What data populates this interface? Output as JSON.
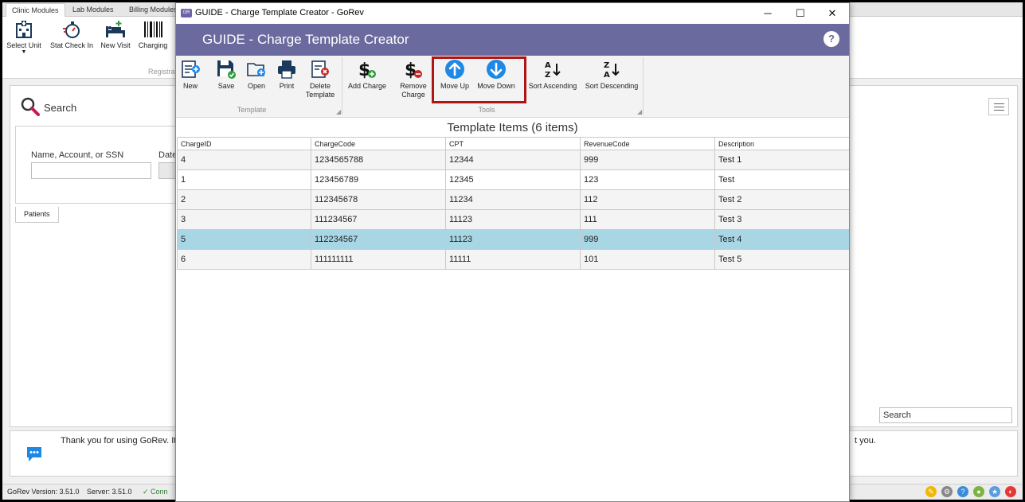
{
  "app": {
    "module_tabs": [
      "Clinic Modules",
      "Lab Modules",
      "Billing Modules"
    ],
    "ribbon": {
      "select_unit": "Select Unit",
      "stat_check_in": "Stat Check In",
      "new_visit": "New Visit",
      "charging": "Charging",
      "group_label": "Registra"
    },
    "search": {
      "title": "Search",
      "name_label": "Name, Account, or SSN",
      "date_label": "Date",
      "patients_tab": "Patients",
      "search_placeholder": "Search"
    },
    "message": {
      "text": "Thank you for using GoRev.  It",
      "text_right": "t you."
    },
    "status": {
      "version": "GoRev Version: 3.51.0",
      "server": "Server: 3.51.0",
      "conn": "✓ Conn"
    }
  },
  "dialog": {
    "window_title": "GUIDE - Charge Template Creator - GoRev",
    "header_title": "GUIDE - Charge Template Creator",
    "help": "?",
    "buttons": {
      "new": "New",
      "save": "Save",
      "open": "Open",
      "print": "Print",
      "delete_template": "Delete Template",
      "add_charge": "Add Charge",
      "remove_charge": "Remove Charge",
      "move_up": "Move Up",
      "move_down": "Move Down",
      "sort_ascending": "Sort Ascending",
      "sort_descending": "Sort Descending"
    },
    "groups": {
      "template": "Template",
      "tools": "Tools"
    },
    "grid_title": "Template Items (6 items)",
    "columns": [
      "ChargeID",
      "ChargeCode",
      "CPT",
      "RevenueCode",
      "Description"
    ],
    "rows": [
      [
        "4",
        "1234565788",
        "12344",
        "999",
        "Test 1"
      ],
      [
        "1",
        "123456789",
        "12345",
        "123",
        "Test"
      ],
      [
        "2",
        "112345678",
        "11234",
        "112",
        "Test 2"
      ],
      [
        "3",
        "111234567",
        "11123",
        "111",
        "Test 3"
      ],
      [
        "5",
        "112234567",
        "11123",
        "999",
        "Test 4"
      ],
      [
        "6",
        "111111111",
        "11111",
        "101",
        "Test 5"
      ]
    ],
    "selected_row_index": 4
  },
  "colors": {
    "header_band": "#6a6a9e",
    "selected_row": "#a8d6e5",
    "highlight_box": "#b01515",
    "move_button_blue": "#1e88e5"
  }
}
